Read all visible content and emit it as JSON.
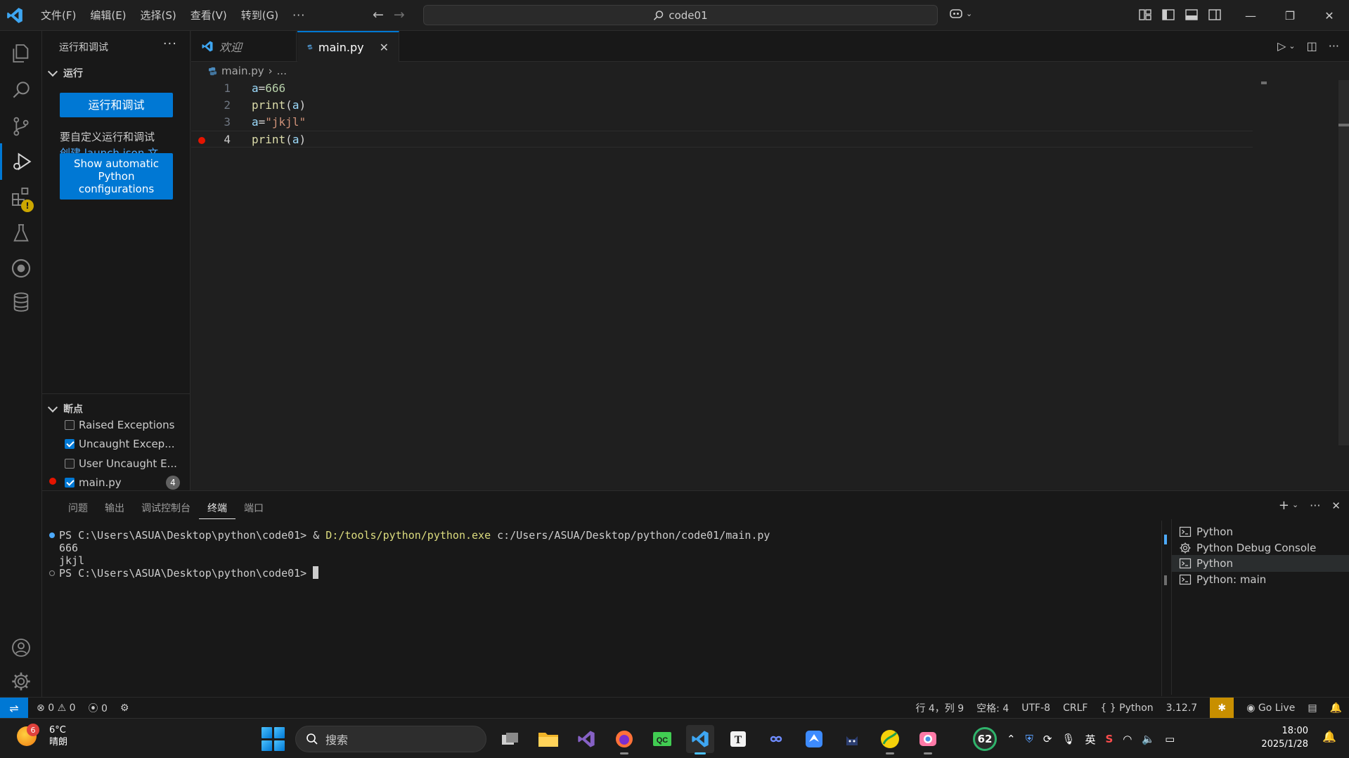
{
  "window": {
    "menu": [
      "文件(F)",
      "编辑(E)",
      "选择(S)",
      "查看(V)",
      "转到(G)"
    ],
    "more": "···",
    "search": "code01"
  },
  "sidebar": {
    "title": "运行和调试",
    "more": "···",
    "run_section": "运行",
    "run_button": "运行和调试",
    "customize_text": "要自定义运行和调试",
    "create_link": "创建 launch.json 文件",
    "period": "。",
    "python_button": "Show automatic Python configurations",
    "breakpoints_section": "断点",
    "breakpoints": [
      {
        "label": "Raised Exceptions",
        "checked": false
      },
      {
        "label": "Uncaught Excep...",
        "checked": true
      },
      {
        "label": "User Uncaught E...",
        "checked": false
      },
      {
        "label": "main.py",
        "checked": true,
        "count": "4"
      }
    ]
  },
  "tabs": [
    {
      "label": "欢迎"
    },
    {
      "label": "main.py",
      "close": "✕"
    }
  ],
  "breadcrumb": {
    "file": "main.py",
    "sep": "›",
    "rest": "..."
  },
  "code_lines": [
    {
      "num": "1",
      "parts": [
        [
          "tok-var",
          "a"
        ],
        [
          "tok-op",
          "="
        ],
        [
          "tok-num",
          "666"
        ]
      ]
    },
    {
      "num": "2",
      "parts": [
        [
          "tok-fn",
          "print"
        ],
        [
          "tok-op",
          "("
        ],
        [
          "tok-var",
          "a"
        ],
        [
          "tok-op",
          ")"
        ]
      ]
    },
    {
      "num": "3",
      "parts": [
        [
          "tok-var",
          "a"
        ],
        [
          "tok-op",
          "="
        ],
        [
          "tok-str",
          "\"jkjl\""
        ]
      ]
    },
    {
      "num": "4",
      "parts": [
        [
          "tok-fn",
          "print"
        ],
        [
          "tok-op",
          "("
        ],
        [
          "tok-var",
          "a"
        ],
        [
          "tok-op",
          ")"
        ]
      ]
    }
  ],
  "panel": {
    "tabs": [
      "问题",
      "输出",
      "调试控制台",
      "终端",
      "端口"
    ],
    "active_tab": 3,
    "terminal": {
      "line1_prompt": "PS C:\\Users\\ASUA\\Desktop\\python\\code01> & ",
      "line1_exe": "D:/tools/python/python.exe",
      "line1_arg": " c:/Users/ASUA/Desktop/python/code01/main.py",
      "out1": "666",
      "out2": "jkjl",
      "line4_prompt": "PS C:\\Users\\ASUA\\Desktop\\python\\code01> "
    },
    "terminals": [
      "Python",
      "Python Debug Console",
      "Python",
      "Python: main"
    ],
    "selected_terminal": 2
  },
  "status": {
    "errors": "0",
    "warnings": "0",
    "ports": "0",
    "position": "行 4，列 9",
    "spaces": "空格: 4",
    "encoding": "UTF-8",
    "eol": "CRLF",
    "language": "Python",
    "version": "3.12.7",
    "golive": "Go Live"
  },
  "taskbar": {
    "temp": "6°C",
    "weather": "晴朗",
    "weather_badge": "6",
    "search": "搜索",
    "badge": "62",
    "ime": "英",
    "time": "18:00",
    "date": "2025/1/28"
  },
  "colors": {
    "accent": "#0078d4",
    "breakpoint": "#e51400",
    "background": "#1f1f1f"
  }
}
